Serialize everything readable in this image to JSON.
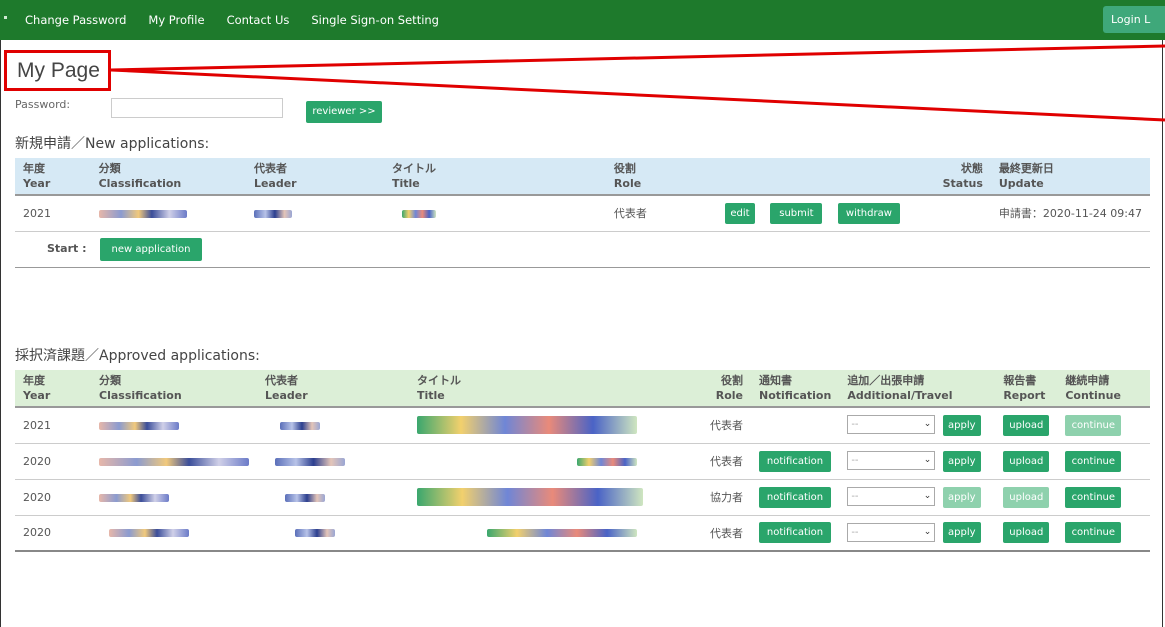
{
  "nav": {
    "links": [
      "Change Password",
      "My Profile",
      "Contact Us",
      "Single Sign-on Setting"
    ],
    "login": "Login L"
  },
  "page_title": "My Page",
  "password": {
    "label": "Password:",
    "value": "",
    "button": "reviewer >>"
  },
  "new_applications": {
    "title": "新規申請／New applications:",
    "headers": {
      "year": [
        "年度",
        "Year"
      ],
      "classification": [
        "分類",
        "Classification"
      ],
      "leader": [
        "代表者",
        "Leader"
      ],
      "title": [
        "タイトル",
        "Title"
      ],
      "role": [
        "役割",
        "Role"
      ],
      "status": [
        "状態",
        "Status"
      ],
      "update": [
        "最終更新日",
        "Update"
      ]
    },
    "rows": [
      {
        "year": "2021",
        "role": "代表者",
        "edit": "edit",
        "submit": "submit",
        "withdraw": "withdraw",
        "update": "申請書：2020-11-24 09:47"
      }
    ],
    "start_label": "Start :",
    "new_button": "new application"
  },
  "approved_applications": {
    "title": "採択済課題／Approved applications:",
    "headers": {
      "year": [
        "年度",
        "Year"
      ],
      "classification": [
        "分類",
        "Classification"
      ],
      "leader": [
        "代表者",
        "Leader"
      ],
      "title": [
        "タイトル",
        "Title"
      ],
      "role": [
        "役割",
        "Role"
      ],
      "notification": [
        "通知書",
        "Notification"
      ],
      "additional": [
        "追加／出張申請",
        "Additional/Travel"
      ],
      "report": [
        "報告書",
        "Report"
      ],
      "continue": [
        "継続申請",
        "Continue"
      ]
    },
    "select_placeholder": "--",
    "apply": "apply",
    "notification": "notification",
    "upload": "upload",
    "continue": "continue",
    "rows": [
      {
        "year": "2021",
        "role": "代表者"
      },
      {
        "year": "2020",
        "role": "代表者"
      },
      {
        "year": "2020",
        "role": "協力者"
      },
      {
        "year": "2020",
        "role": "代表者"
      }
    ]
  }
}
